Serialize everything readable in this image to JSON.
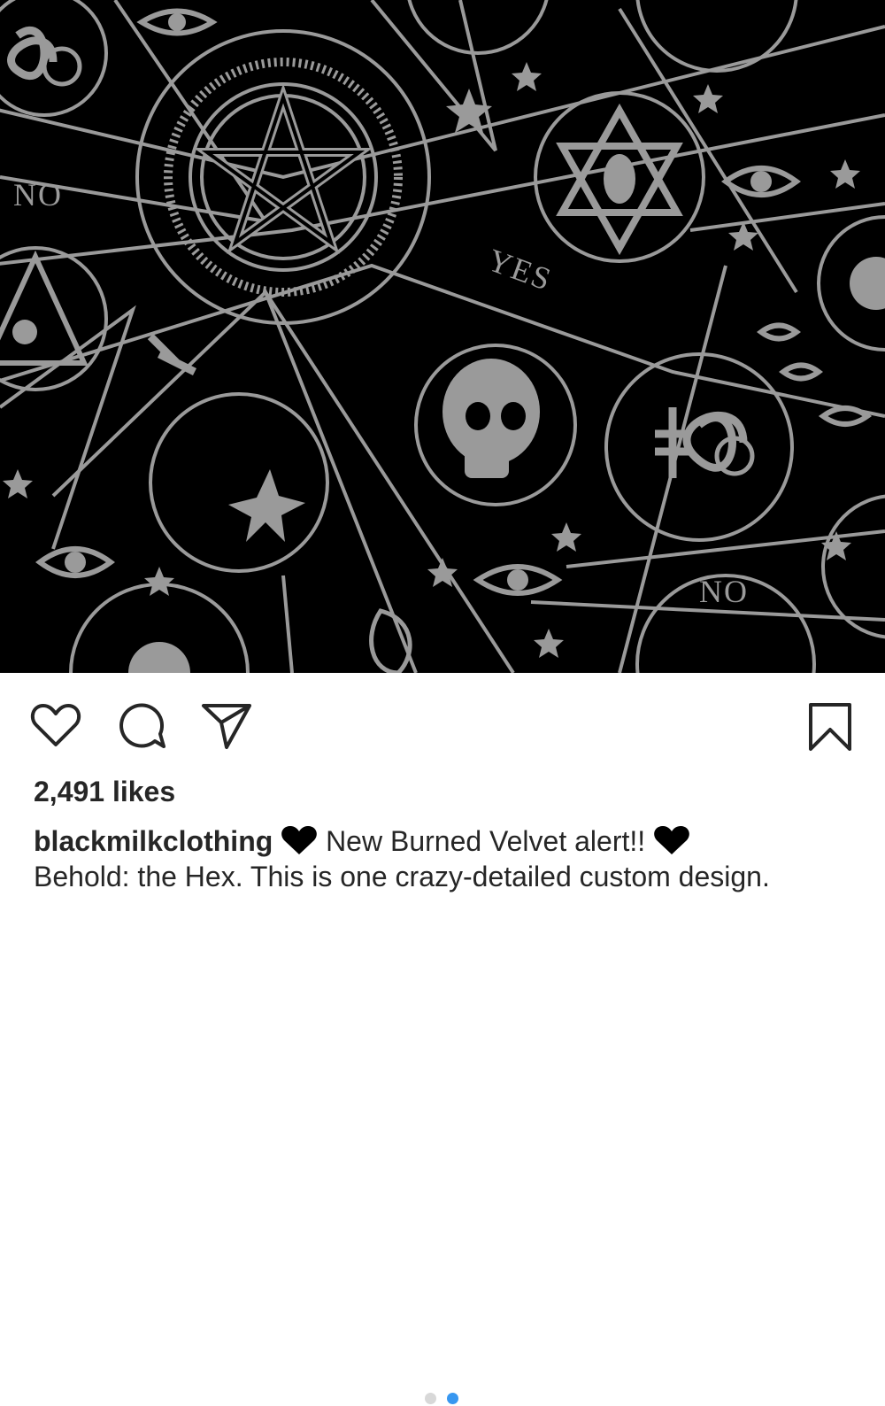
{
  "post": {
    "image_texts": [
      "NO",
      "YES",
      "NO"
    ],
    "image_description_icons": [
      "ouroboros-pentagram",
      "eye-icon",
      "skull",
      "crescent-moon",
      "sun",
      "sigil",
      "moth",
      "eye-triangle"
    ]
  },
  "actions": {
    "like_icon": "heart-outline-icon",
    "comment_icon": "comment-bubble-icon",
    "share_icon": "paper-plane-icon",
    "save_icon": "bookmark-outline-icon",
    "carousel": {
      "total": 2,
      "active": 2
    },
    "accent_color": "#3897f0",
    "inactive_dot_color": "#d8d8d8"
  },
  "likes": {
    "count_text": "2,491 likes"
  },
  "caption": {
    "username": "blackmilkclothing",
    "emoji": "black-heart",
    "line1_text": "New Burned Velvet alert!!",
    "line2_text": "Behold: the Hex. This is one crazy-detailed custom design."
  },
  "colors": {
    "pattern_fg": "#9a9a9a",
    "pattern_bg": "#000000",
    "text": "#262626"
  }
}
